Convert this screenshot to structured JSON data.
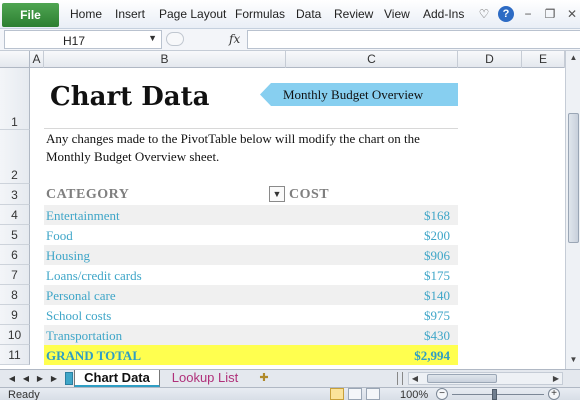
{
  "ribbon": {
    "file_label": "File",
    "tabs": [
      "Home",
      "Insert",
      "Page Layout",
      "Formulas",
      "Data",
      "Review",
      "View",
      "Add-Ins"
    ],
    "icons": [
      "heart-icon",
      "help-icon",
      "minimize-icon",
      "restore-icon",
      "close-icon"
    ],
    "help_glyph": "?"
  },
  "formula_bar": {
    "name_box": "H17",
    "fx_label": "fx",
    "content": ""
  },
  "columns": [
    "A",
    "B",
    "C",
    "D",
    "E"
  ],
  "rows": [
    "1",
    "2",
    "3",
    "4",
    "5",
    "6",
    "7",
    "8",
    "9",
    "10",
    "11"
  ],
  "sheet": {
    "title": "Chart Data",
    "banner": "Monthly  Budget Overview",
    "note": "Any changes made to the PivotTable below will modify the chart on the Monthly Budget Overview sheet.",
    "category_header": "CATEGORY",
    "cost_header": "COST",
    "items": [
      {
        "name": "Entertainment",
        "cost": "$168"
      },
      {
        "name": "Food",
        "cost": "$200"
      },
      {
        "name": "Housing",
        "cost": "$906"
      },
      {
        "name": "Loans/credit cards",
        "cost": "$175"
      },
      {
        "name": "Personal care",
        "cost": "$140"
      },
      {
        "name": "School costs",
        "cost": "$975"
      },
      {
        "name": "Transportation",
        "cost": "$430"
      }
    ],
    "total_label": "GRAND TOTAL",
    "total_value": "$2,994"
  },
  "sheet_tabs": {
    "active": "Chart Data",
    "other": "Lookup List"
  },
  "status_bar": {
    "status": "Ready",
    "zoom": "100%"
  },
  "colors": {
    "file_tab": "#2c7f31",
    "banner": "#87cff0",
    "link_text": "#3fa6c8",
    "total_fill": "#ffff4f",
    "header_gray": "#7f7f7f"
  }
}
